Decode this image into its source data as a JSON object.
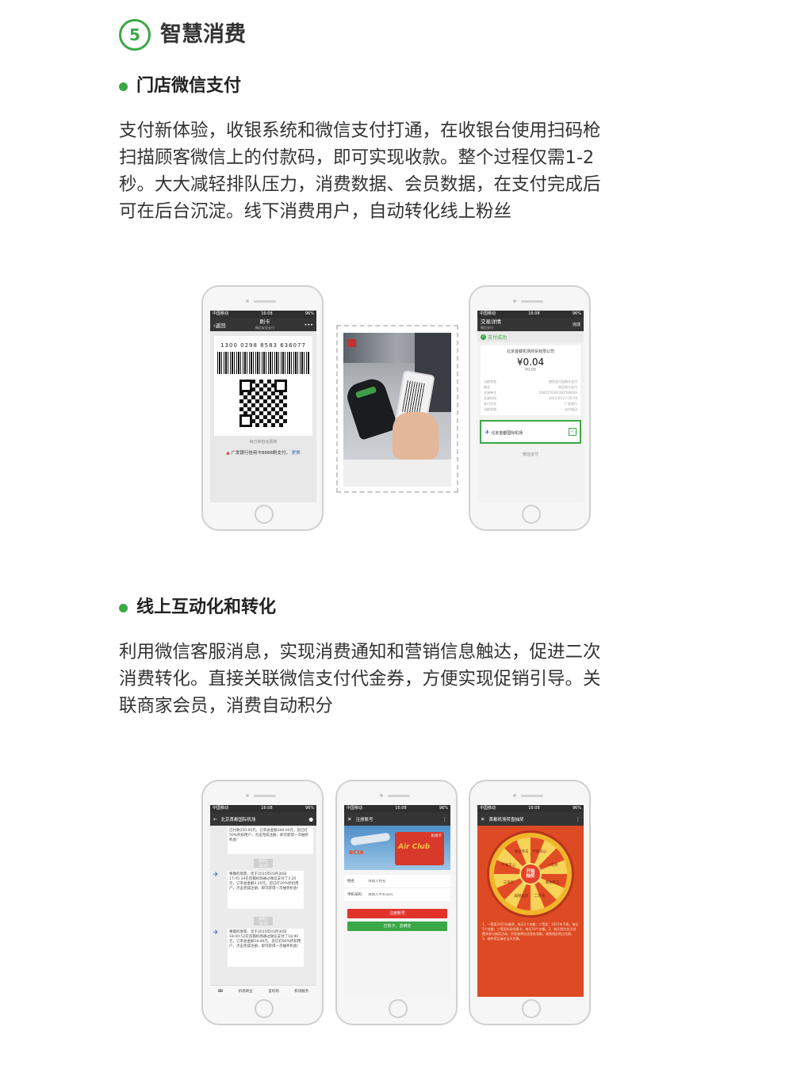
{
  "section": {
    "number": "5",
    "title": "智慧消费"
  },
  "store_pay": {
    "title": "门店微信支付",
    "lines": [
      "支付新体验，收银系统和微信支付打通，在收银台使用扫码枪",
      "扫描顾客微信上的付款码，即可实现收款。整个过程仅需1-2",
      "秒。大大减轻排队压力，消费数据、会员数据，在支付完成后",
      "可在后台沉淀。线下消费用户，自动转化线上粉丝"
    ],
    "phone1": {
      "status_carrier": "中国移动",
      "status_time": "16:08",
      "status_battery": "96%",
      "back": "返回",
      "nav_title": "刷卡",
      "nav_sub": "微信安全支付",
      "barcode_number": "1300 0298 8583 636077",
      "refresh_hint": "每分钟自动更新",
      "bank_text": "广发银行信用卡8888刷支付",
      "bank_link": "更换"
    },
    "phone2": {
      "status_carrier": "中国移动",
      "status_time": "16:08",
      "status_battery": "96%",
      "nav_title": "交易详情",
      "nav_sub": "微信支付",
      "nav_done": "完成",
      "success": "支付成功",
      "merchant": "北京首都机场商贸有限公司",
      "amount": "¥0.04",
      "amount_sub": "¥0.05",
      "rows": [
        [
          "当前状态",
          "使用支付宝刷卡支付"
        ],
        [
          "商品",
          "商品和卡支付"
        ],
        [
          "交易单号",
          "1002570267202590000"
        ],
        [
          "交易时间",
          "2015-03-27 20:56"
        ],
        [
          "支付方式",
          "广发银行"
        ],
        [
          "当前状态",
          "支付成功"
        ]
      ],
      "follow": "北京首都国际机场",
      "footer": "微信支付"
    }
  },
  "online": {
    "title": "线上互动化和转化",
    "lines": [
      "利用微信客服消息，实现消费通知和营销信息触达，促进二次",
      "消费转化。直接关联微信支付代金券，方便实现促销引导。关",
      "联商家会员，消费自动积分"
    ],
    "phone_a": {
      "status_carrier": "中国移动",
      "status_time": "16:08",
      "status_battery": "96%",
      "nav_title": "北京首都国际机场",
      "msg0": "已付款250.00元，订单总金额300.00元，您已打50%折扣用户，点击完成注册，即可获得一次抽奖机会!",
      "time1": "星期五 18:45",
      "msg1": "尊敬的旅客，您于2015年03月30日 17:45:34在首都机场通过微信支付了3.20元，订单总金额3.20元。您已打20%折扣用户，点击完成注册，即可获得一次抽奖机会!",
      "time2": "星期五 18:00",
      "msg2": "尊敬的旅客，您于2015年03月30日 18:00:52在首都机场通过微信支付了18.90元，订单总金额18.90元，您已打80%折扣用户，点击完成注册，即可获得一次抽奖机会!",
      "menu": [
        "机场商业",
        "首机场",
        "机场服务"
      ]
    },
    "phone_b": {
      "status_carrier": "中国移动",
      "status_time": "16:08",
      "status_battery": "96%",
      "nav_title": "注册账号",
      "banner_brand": "BCIA",
      "banner_club": "Air Club",
      "banner_card": "机场卡",
      "name_label": "姓名",
      "name_placeholder": "请输入姓名",
      "phone_label": "手机号码",
      "phone_placeholder": "请输入手机号码",
      "register_btn": "注册账号",
      "bind_btn": "已有卡，去绑定"
    },
    "phone_c": {
      "status_carrier": "中国移动",
      "status_time": "16:08",
      "status_battery": "96%",
      "nav_title": "首都机场转盘抽奖",
      "center": "开始抽奖",
      "prizes": [
        "不要灰心",
        "一等奖",
        "谢谢参与",
        "二等奖",
        "再接再厉",
        "三等奖",
        "不要灰心",
        "谢谢参与"
      ],
      "rules": "1、一等奖2015年春季，每天1个名额；二等奖：2015年手表，每日5个名额；三等奖机场优惠卡，每日10个名额。2、每天首次关注消费并参与抽奖活动，中奖者将在信息处领取，请到指定地点兑换。3、抽中奖品请在当天兑换。"
    }
  }
}
